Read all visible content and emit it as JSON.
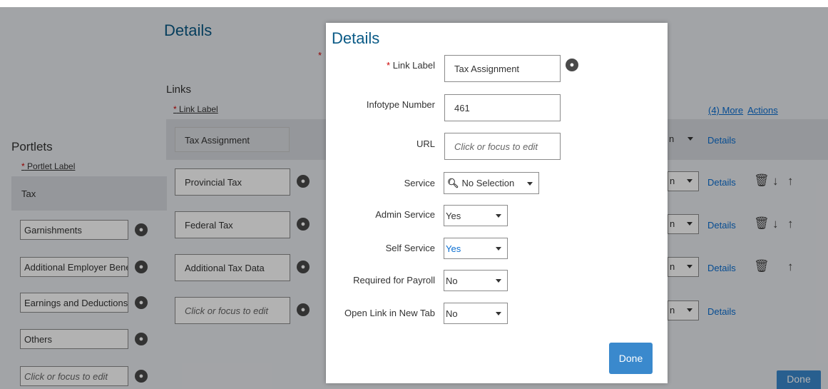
{
  "colors": {
    "title_blue": "#0a5a86",
    "link_blue": "#0a6ed1",
    "done_button": "#3a89cd",
    "required_star": "#cc0000"
  },
  "portlets": {
    "title": "Portlets",
    "column_header_req": "*",
    "column_header": "Portlet Label",
    "selected": "Tax",
    "items": [
      "Garnishments",
      "Additional Employer Bene",
      "Earnings and Deductions",
      "Others"
    ],
    "new_placeholder": "Click or focus to edit"
  },
  "panel": {
    "title": "Details",
    "required_star": "*",
    "links_title": "Links",
    "links_column_header_req": "*",
    "links_column_header": "Link Label",
    "selected_link": "Tax Assignment",
    "links": [
      "Provincial Tax",
      "Federal Tax",
      "Additional Tax Data"
    ],
    "new_placeholder": "Click or focus to edit",
    "more_label": "(4) More",
    "actions_label": "Actions",
    "row_select_value": "n",
    "details_label": "Details",
    "done_label": "Done"
  },
  "modal": {
    "title": "Details",
    "link_label_req": "*",
    "link_label": "Link Label",
    "link_label_value": "Tax Assignment",
    "infotype_label": "Infotype Number",
    "infotype_value": "461",
    "url_label": "URL",
    "url_placeholder": "Click or focus to edit",
    "service_label": "Service",
    "service_value": "No Selection",
    "admin_service_label": "Admin Service",
    "admin_service_value": "Yes",
    "self_service_label": "Self Service",
    "self_service_value": "Yes",
    "required_payroll_label": "Required for Payroll",
    "required_payroll_value": "No",
    "open_new_tab_label": "Open Link in New Tab",
    "open_new_tab_value": "No",
    "done_label": "Done"
  },
  "icons": {
    "globe": "globe-icon",
    "trash": "trash-icon",
    "down": "arrow-down-icon",
    "up": "arrow-up-icon",
    "search": "search-icon",
    "dropdown": "chevron-down-icon"
  }
}
